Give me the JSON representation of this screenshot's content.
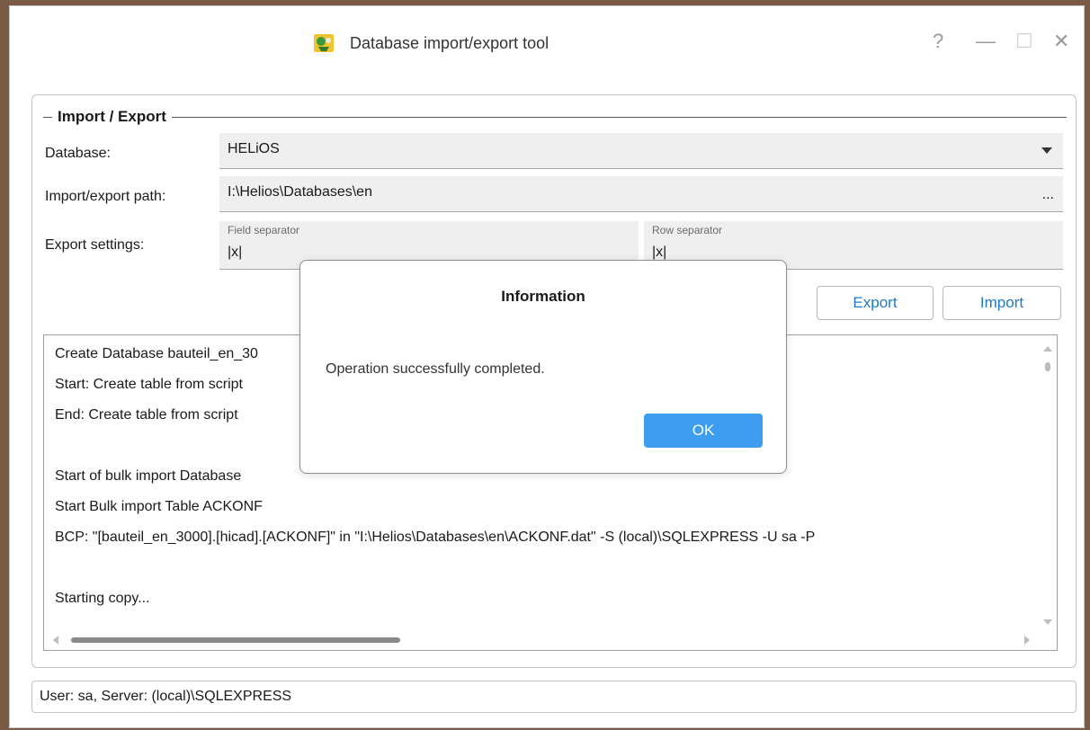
{
  "window": {
    "title": "Database import/export tool",
    "controls": {
      "help": "?",
      "minimize": "—",
      "maximize": "☐",
      "close": "✕"
    }
  },
  "group": {
    "title": "Import / Export",
    "database_label": "Database:",
    "database_value": "HELiOS",
    "path_label": "Import/export path:",
    "path_value": "I:\\Helios\\Databases\\en",
    "browse_label": "...",
    "export_settings_label": "Export settings:",
    "field_separator_caption": "Field separator",
    "field_separator_value": "|x|",
    "row_separator_caption": "Row separator",
    "row_separator_value": "|x|",
    "export_button": "Export",
    "import_button": "Import"
  },
  "log": {
    "lines": [
      "Create Database bauteil_en_30",
      "Start: Create table from script",
      "End: Create table from script",
      "",
      "Start of bulk import Database",
      "Start Bulk import Table ACKONF",
      "BCP: \"[bauteil_en_3000].[hicad].[ACKONF]\" in \"I:\\Helios\\Databases\\en\\ACKONF.dat\" -S (local)\\SQLEXPRESS -U sa -P",
      "",
      "Starting copy..."
    ]
  },
  "status": {
    "text": "User: sa, Server: (local)\\SQLEXPRESS"
  },
  "dialog": {
    "title": "Information",
    "message": "Operation successfully completed.",
    "ok_button": "OK"
  },
  "colors": {
    "accent_blue": "#1f78d1",
    "ok_button_bg": "#3d9ef0",
    "field_bg": "#efefef"
  }
}
